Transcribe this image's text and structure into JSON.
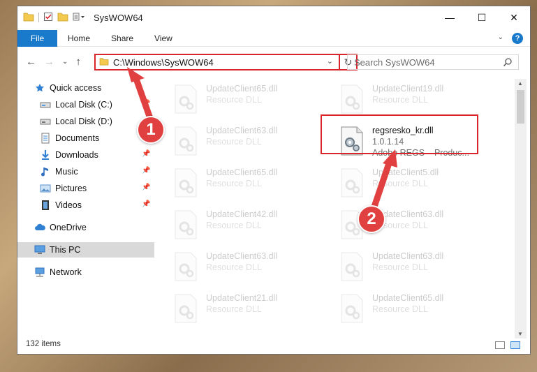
{
  "window": {
    "title": "SysWOW64",
    "controls": {
      "minimize": "—",
      "maximize": "☐",
      "close": "✕"
    }
  },
  "ribbon": {
    "file_tab": "File",
    "tabs": [
      "Home",
      "Share",
      "View"
    ],
    "help": "?"
  },
  "address_bar": {
    "path": "C:\\Windows\\SysWOW64"
  },
  "search": {
    "placeholder": "Search SysWOW64"
  },
  "sidebar": {
    "items": [
      {
        "label": "Quick access",
        "icon": "star-icon",
        "pinned": false
      },
      {
        "label": "Local Disk (C:)",
        "icon": "drive-icon",
        "pinned": true
      },
      {
        "label": "Local Disk (D:)",
        "icon": "drive-icon",
        "pinned": false
      },
      {
        "label": "Documents",
        "icon": "documents-icon",
        "pinned": true
      },
      {
        "label": "Downloads",
        "icon": "downloads-icon",
        "pinned": true
      },
      {
        "label": "Music",
        "icon": "music-icon",
        "pinned": true
      },
      {
        "label": "Pictures",
        "icon": "pictures-icon",
        "pinned": true
      },
      {
        "label": "Videos",
        "icon": "videos-icon",
        "pinned": true
      },
      {
        "label": "OneDrive",
        "icon": "cloud-icon",
        "pinned": false
      },
      {
        "label": "This PC",
        "icon": "computer-icon",
        "pinned": false,
        "selected": true
      },
      {
        "label": "Network",
        "icon": "network-icon",
        "pinned": false
      }
    ]
  },
  "files": {
    "left_column": [
      {
        "name": "UpdateClient65.dll",
        "type": "Resource DLL"
      },
      {
        "name": "UpdateClient63.dll",
        "type": "Resource DLL"
      },
      {
        "name": "UpdateClient65.dll",
        "type": "Resource DLL"
      },
      {
        "name": "UpdateClient42.dll",
        "type": "Resource DLL"
      },
      {
        "name": "UpdateClient63.dll",
        "type": "Resource DLL"
      },
      {
        "name": "UpdateClient21.dll",
        "type": "Resource DLL"
      }
    ],
    "right_column": [
      {
        "name": "UpdateClient19.dll",
        "type": "Resource DLL"
      },
      {
        "name": "UpdateClient5.dll",
        "type": "Resource DLL"
      },
      {
        "name": "UpdateClient63.dll",
        "type": "Resource DLL"
      },
      {
        "name": "UpdateClient63.dll",
        "type": "Resource DLL"
      },
      {
        "name": "UpdateClient65.dll",
        "type": "Resource DLL"
      }
    ],
    "featured": {
      "name": "regsresko_kr.dll",
      "version": "1.0.1.14",
      "company": "Adobe REGS",
      "product": "Produc..."
    }
  },
  "status_bar": {
    "item_count": "132 items"
  },
  "annotations": {
    "step1": "1",
    "step2": "2",
    "color": "#e0403f"
  }
}
